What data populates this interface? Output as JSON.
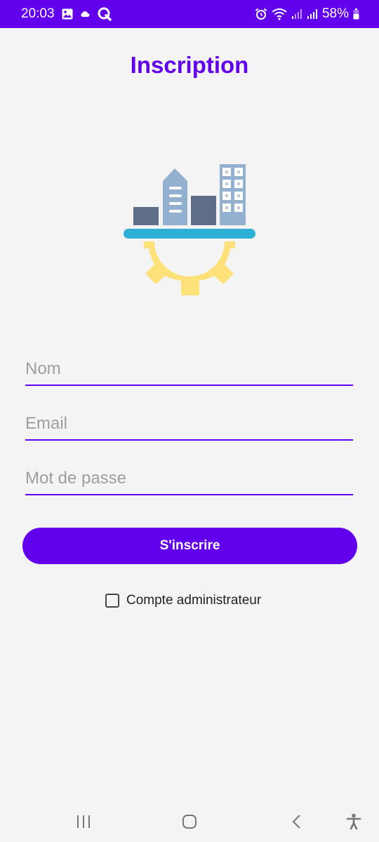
{
  "status_bar": {
    "time": "20:03",
    "battery": "58%",
    "left_icons": [
      "gallery-icon",
      "cloud-icon",
      "q-app-icon"
    ],
    "right_icons": [
      "alarm-icon",
      "wifi-icon",
      "signal-icon",
      "signal-icon",
      "battery-icon"
    ]
  },
  "header": {
    "title": "Inscription"
  },
  "illustration": {
    "icon": "city-gear-illustration"
  },
  "form": {
    "name_placeholder": "Nom",
    "name_value": "",
    "email_placeholder": "Email",
    "email_value": "",
    "password_placeholder": "Mot de passe",
    "password_value": ""
  },
  "actions": {
    "signup_label": "S'inscrire",
    "admin_checkbox_label": "Compte administrateur",
    "admin_checked": false
  },
  "nav_bar": {
    "icons": [
      "recent-apps-icon",
      "home-icon",
      "back-icon",
      "accessibility-icon"
    ]
  },
  "colors": {
    "primary": "#6200ee",
    "background": "#f4f4f4",
    "gear": "#ffe17a",
    "platform": "#2eb0d6",
    "building_dark": "#5e6e86",
    "building_light": "#93b0d0"
  }
}
